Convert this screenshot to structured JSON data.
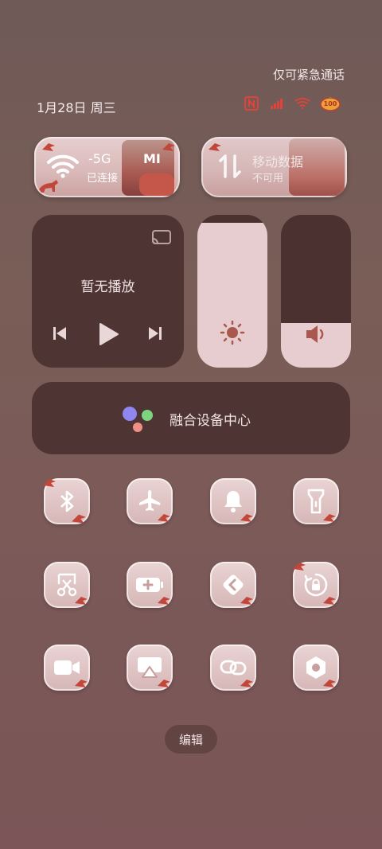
{
  "status": {
    "emergency_text": "仅可紧急通话",
    "date_text": "1月28日 周三",
    "battery_text": "100"
  },
  "wifi_tile": {
    "title": "-5G",
    "subtitle": "已连接",
    "badge": "MI"
  },
  "data_tile": {
    "title": "移动数据",
    "subtitle": "不可用"
  },
  "media": {
    "title": "暂无播放"
  },
  "device_center": {
    "label": "融合设备中心"
  },
  "brightness": {
    "level": 0.95
  },
  "volume": {
    "level": 0.29
  },
  "toggles": [
    {
      "name": "bluetooth",
      "icon": "bluetooth-icon"
    },
    {
      "name": "airplane-mode",
      "icon": "airplane-icon"
    },
    {
      "name": "ringtone",
      "icon": "bell-icon"
    },
    {
      "name": "flashlight",
      "icon": "flashlight-icon"
    },
    {
      "name": "screenshot",
      "icon": "scissors-icon"
    },
    {
      "name": "battery-saver",
      "icon": "battery-plus-icon"
    },
    {
      "name": "hotspot",
      "icon": "diamond-arrows-icon"
    },
    {
      "name": "rotation-lock",
      "icon": "rotation-lock-icon"
    },
    {
      "name": "screen-record",
      "icon": "video-camera-icon"
    },
    {
      "name": "screen-cast",
      "icon": "airplay-icon"
    },
    {
      "name": "nfc-link",
      "icon": "link-icon"
    },
    {
      "name": "settings",
      "icon": "hex-gear-icon"
    }
  ],
  "edit": {
    "label": "编辑"
  },
  "colors": {
    "tile_bg": "#e7cfcf",
    "panel_bg": "#4e3533",
    "icon": "#ffffff",
    "accent_red": "#d2463c"
  }
}
